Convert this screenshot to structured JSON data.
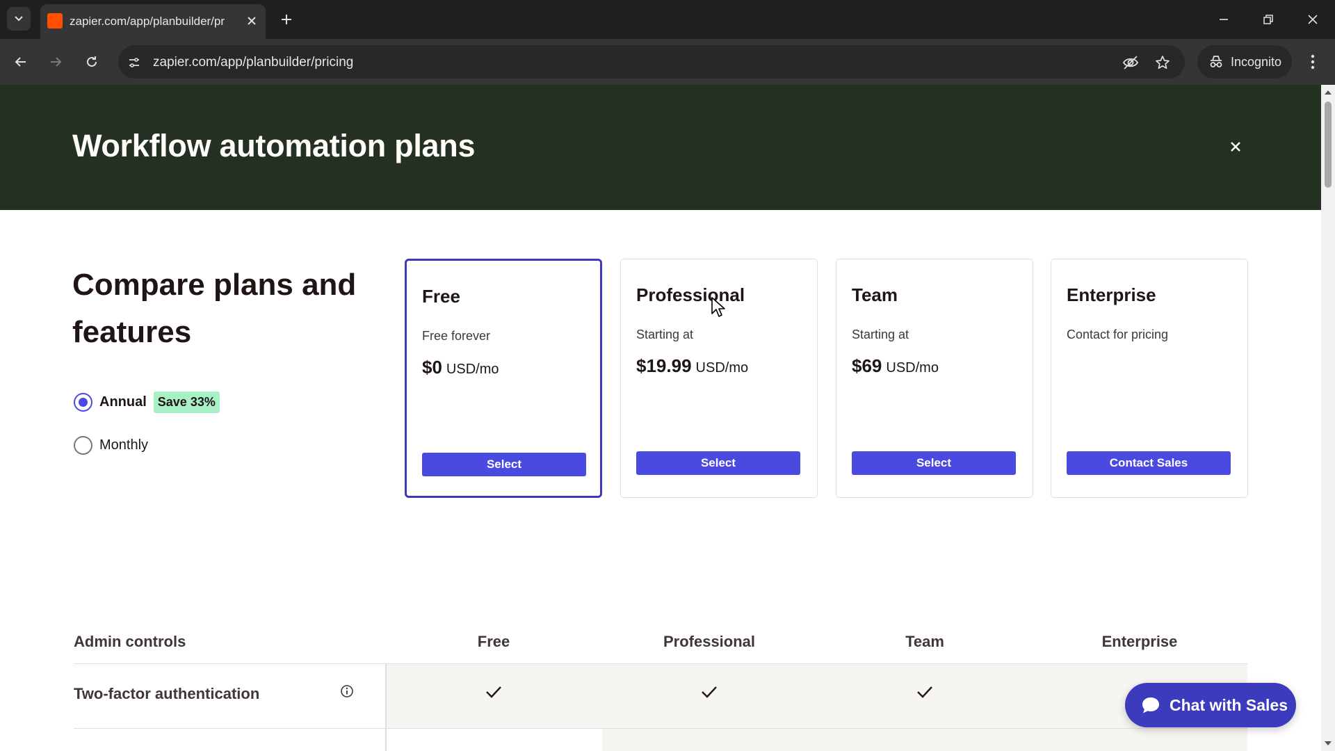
{
  "browser": {
    "tab": {
      "title": "zapier.com/app/planbuilder/pr"
    },
    "address": {
      "url": "zapier.com/app/planbuilder/pricing"
    },
    "profile": {
      "label": "Incognito"
    }
  },
  "hero": {
    "title": "Workflow automation plans"
  },
  "compare": {
    "title": "Compare plans and features",
    "billing": {
      "annual_label": "Annual",
      "save_badge": "Save 33%",
      "monthly_label": "Monthly",
      "selected": "Annual"
    }
  },
  "plans": [
    {
      "name": "Free",
      "subtitle": "Free forever",
      "amount": "$0",
      "unit": "USD/mo",
      "button": "Select",
      "selected": true
    },
    {
      "name": "Professional",
      "subtitle": "Starting at",
      "amount": "$19.99",
      "unit": "USD/mo",
      "button": "Select",
      "selected": false
    },
    {
      "name": "Team",
      "subtitle": "Starting at",
      "amount": "$69",
      "unit": "USD/mo",
      "button": "Select",
      "selected": false
    },
    {
      "name": "Enterprise",
      "subtitle": "Contact for pricing",
      "amount": "",
      "unit": "",
      "button": "Contact Sales",
      "selected": false
    }
  ],
  "table": {
    "section_title": "Admin controls",
    "columns": [
      "Free",
      "Professional",
      "Team",
      "Enterprise"
    ],
    "rows": [
      {
        "feature": "Two-factor authentication",
        "checks": [
          true,
          true,
          true,
          true
        ]
      }
    ]
  },
  "chat": {
    "label": "Chat with Sales"
  },
  "colors": {
    "hero_bg": "#233022",
    "accent": "#4b4ae0",
    "selected_border": "#3d3bbd",
    "badge_bg": "#a8f0c6",
    "chat_bg": "#3d3bbd"
  },
  "icons": {
    "tab_favicon": "zapier-favicon",
    "tab_close": "close-icon",
    "new_tab": "plus-icon",
    "back": "arrow-left-icon",
    "forward": "arrow-right-icon",
    "reload": "reload-icon",
    "site_info": "tune-icon",
    "eye_off": "eye-off-icon",
    "bookmark": "star-icon",
    "incognito": "incognito-icon",
    "menu": "kebab-menu-icon",
    "hero_close": "close-icon",
    "info": "info-icon",
    "check": "check-icon",
    "chat": "chat-bubble-icon"
  }
}
